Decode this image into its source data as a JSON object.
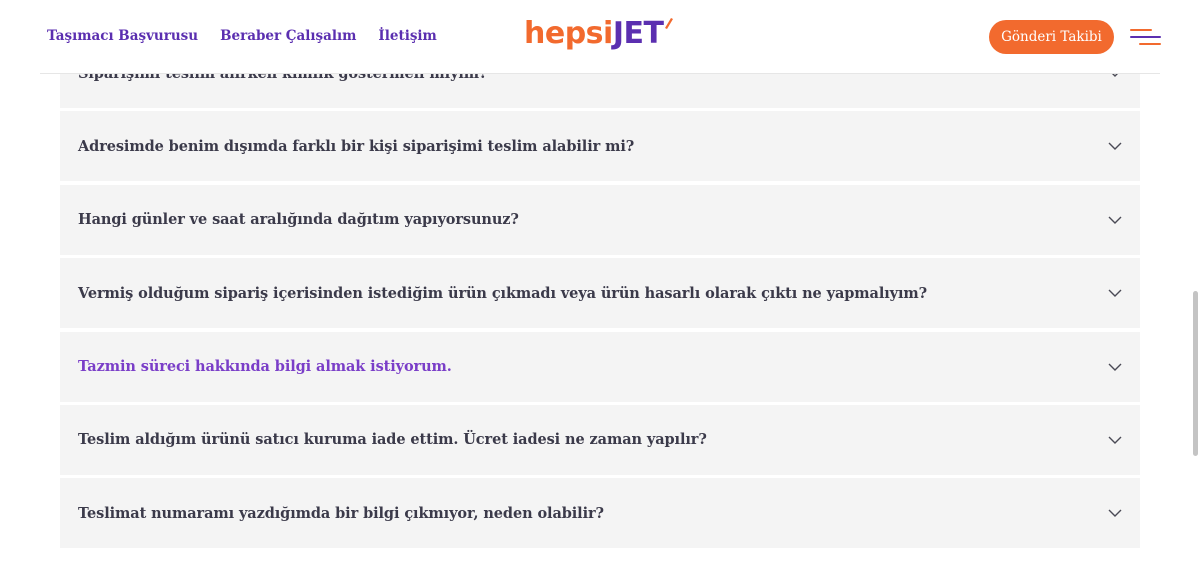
{
  "header": {
    "nav": [
      {
        "label": "Taşımacı Başvurusu"
      },
      {
        "label": "Beraber Çalışalım"
      },
      {
        "label": "İletişim"
      }
    ],
    "logo": {
      "part1": "hepsi",
      "part2": "JET"
    },
    "track_button_label": "Gönderi Takibi",
    "menu_icon": "hamburger-menu-icon"
  },
  "faq": {
    "items": [
      {
        "question": "Siparişimi teslim alırken kimlik göstermeli miyim?",
        "active": false
      },
      {
        "question": "Adresimde benim dışımda farklı bir kişi siparişimi teslim alabilir mi?",
        "active": false
      },
      {
        "question": "Hangi günler ve saat aralığında dağıtım yapıyorsunuz?",
        "active": false
      },
      {
        "question": "Vermiş olduğum sipariş içerisinden istediğim ürün çıkmadı veya ürün hasarlı olarak çıktı ne yapmalıyım?",
        "active": false
      },
      {
        "question": "Tazmin süreci hakkında bilgi almak istiyorum.",
        "active": true
      },
      {
        "question": "Teslim aldığım ürünü satıcı kuruma iade ettim. Ücret iadesi ne zaman yapılır?",
        "active": false
      },
      {
        "question": "Teslimat numaramı yazdığımda bir bilgi çıkmıyor, neden olabilir?",
        "active": false
      }
    ],
    "expand_icon": "chevron-down-icon"
  },
  "colors": {
    "brand_orange": "#f26a2e",
    "brand_purple": "#5b2fb0",
    "active_question": "#7a3ec8",
    "faq_background": "#f4f4f4",
    "question_text": "#3b3a4a"
  }
}
